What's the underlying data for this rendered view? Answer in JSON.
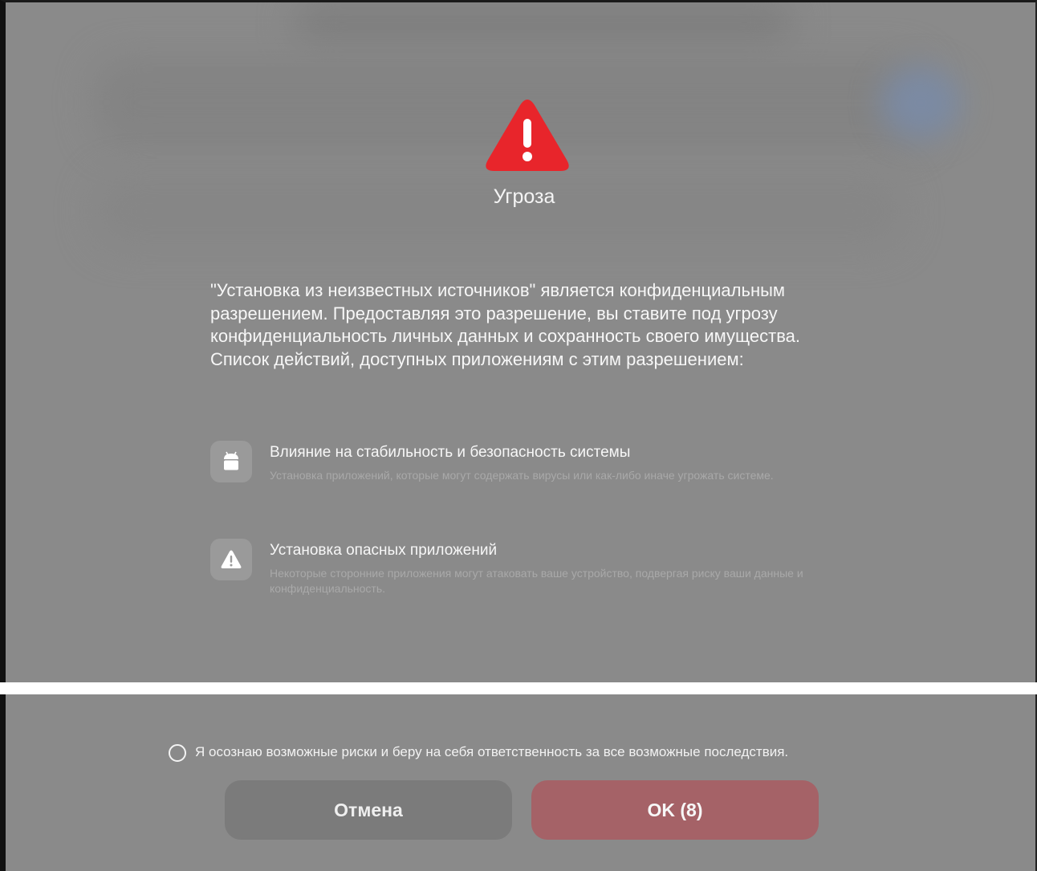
{
  "dialog": {
    "title": "Угроза",
    "description": "\"Установка из неизвестных источников\" является конфиденциальным разрешением. Предоставляя это разрешение, вы ставите под угрозу конфиденциальность личных данных и сохранность своего имущества. Список действий, доступных приложениям с этим разрешением:",
    "items": [
      {
        "icon": "android-icon",
        "title": "Влияние на стабильность и безопасность системы",
        "description": "Установка приложений, которые могут содержать вирусы или как-либо иначе угрожать системе."
      },
      {
        "icon": "warning-icon",
        "title": "Установка опасных приложений",
        "description": "Некоторые сторонние приложения могут атаковать ваше устройство, подвергая риску ваши данные и конфиденциальность."
      }
    ]
  },
  "footer": {
    "consent_text": "Я осознаю возможные риски и беру на себя ответственность за все возможные последствия.",
    "cancel_label": "Отмена",
    "ok_label": "OK (8)"
  },
  "colors": {
    "alert_red": "#e8252b",
    "ok_button": "#a56267",
    "overlay_gray": "#8a8a8a"
  }
}
